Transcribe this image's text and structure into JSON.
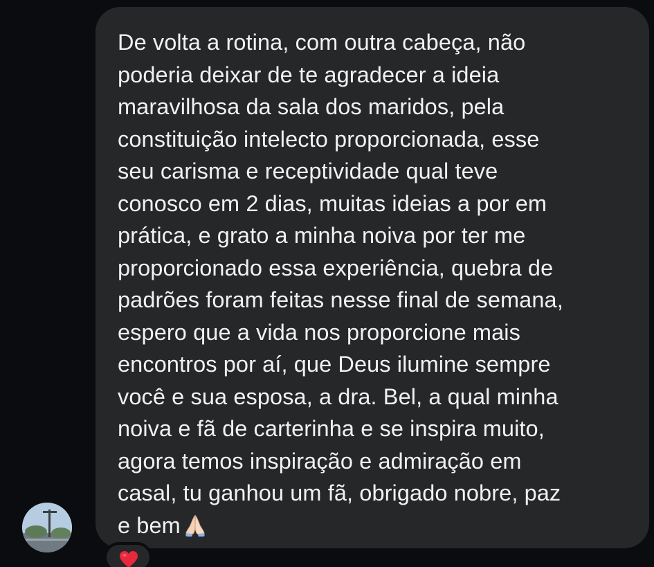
{
  "message": {
    "text": "De volta a rotina, com outra cabeça, não\npoderia deixar de te agradecer a ideia\nmaravilhosa da sala dos maridos, pela\nconstituição intelecto proporcionada, esse\nseu carisma e receptividade qual teve\nconosco em 2 dias, muitas ideias a por em\nprática, e grato a minha noiva por ter me\nproporcionado essa experiência, quebra de\npadrões foram feitas nesse final de semana,\nespero que a vida nos proporcione mais\nencontros por aí, que Deus ilumine sempre\nvocê e sua esposa, a dra. Bel, a qual minha\nnoiva e fã de carterinha e se inspira muito,\nagora temos inspiração e admiração em\ncasal, tu ganhou um fã, obrigado nobre, paz\ne bem",
    "trailing_emoji": "folded-hands-icon"
  },
  "reaction": {
    "icon": "heart-icon",
    "color": "#e8283c"
  },
  "colors": {
    "background": "#0b0c10",
    "bubble": "#262729",
    "text": "#f1f1f1"
  }
}
